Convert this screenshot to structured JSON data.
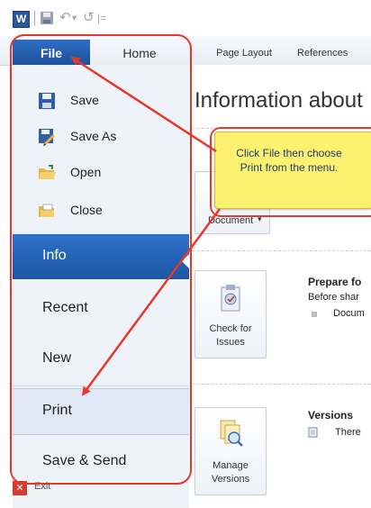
{
  "app": {
    "icon_letter": "W",
    "qat_undo": "↶",
    "qat_redo": "↺",
    "qat_customize": "|="
  },
  "tabs": {
    "file": "File",
    "home": "Home",
    "page_layout": "Page Layout",
    "references": "References"
  },
  "commands": [
    {
      "label": "Save",
      "icon": "save-icon"
    },
    {
      "label": "Save As",
      "icon": "save-as-icon"
    },
    {
      "label": "Open",
      "icon": "open-folder-icon"
    },
    {
      "label": "Close",
      "icon": "close-folder-icon"
    }
  ],
  "nav": {
    "info": "Info",
    "recent": "Recent",
    "new": "New",
    "print": "Print",
    "save_send": "Save & Send",
    "exit": "Exit"
  },
  "main": {
    "title": "Information about",
    "document_button": "Document",
    "check_issues_line1": "Check for",
    "check_issues_line2": "Issues",
    "prepare_title": "Prepare fo",
    "prepare_text": "Before shar",
    "prepare_bullet": "Docum",
    "manage_versions_line1": "Manage",
    "manage_versions_line2": "Versions",
    "versions_title": "Versions",
    "versions_text": "There"
  },
  "callout": {
    "line1": "Click File then choose",
    "line2": "Print from the menu."
  },
  "colors": {
    "file_tab": "#1b4f99",
    "info_selected": "#1c56a6",
    "annotation_red": "#e8362c",
    "callout_yellow": "#fdf16f"
  }
}
